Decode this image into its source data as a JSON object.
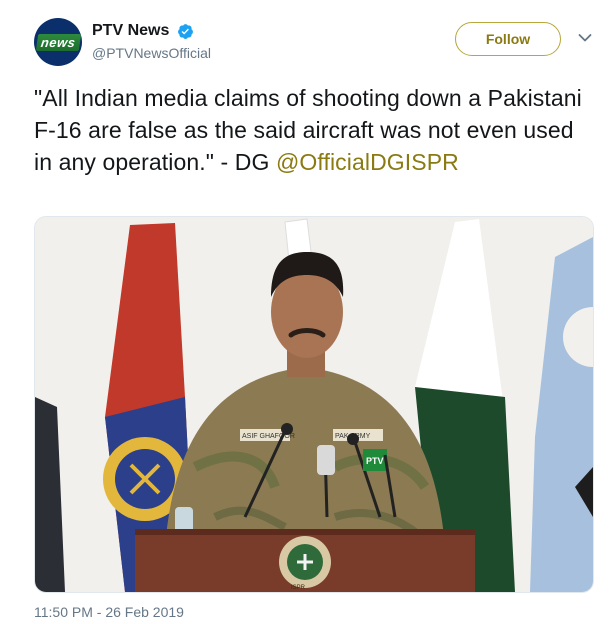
{
  "account": {
    "avatar_text": "news",
    "display_name": "PTV News",
    "handle": "@PTVNewsOfficial",
    "verified": true
  },
  "actions": {
    "follow_label": "Follow",
    "menu_icon": "chevron-down-icon"
  },
  "tweet": {
    "text": "\"All Indian media claims of shooting down a Pakistani F-16 are false as the said aircraft was not even used in any operation.\" - DG ",
    "mention": "@OfficialDGISPR",
    "timestamp": "11:50 PM - 26 Feb 2019"
  },
  "media": {
    "podium_lettering": "ISPR",
    "mic_label": "PTV",
    "name_tag_left": "ASIF GHAFOOR",
    "name_tag_right": "PAK ARMY"
  },
  "colors": {
    "accent": "#8a7a12",
    "verified_blue": "#1da1f2",
    "text": "#14171a",
    "muted": "#657786"
  }
}
